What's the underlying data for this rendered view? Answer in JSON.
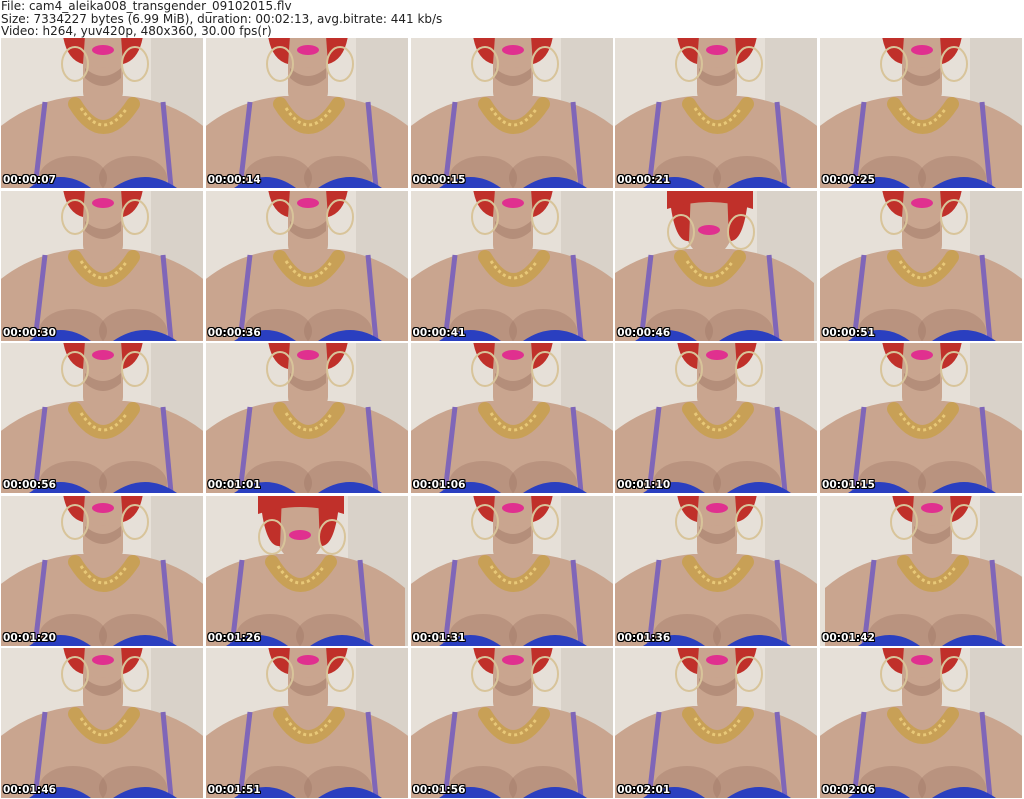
{
  "header": {
    "file_line": "File: cam4_aleika008_transgender_09102015.flv",
    "size_line": "Size: 7334227 bytes (6.99 MiB), duration: 00:02:13, avg.bitrate: 441 kb/s",
    "video_line": "Video: h264, yuv420p, 480x360, 30.00 fps(r)"
  },
  "colors": {
    "wall": "#e6e0d8",
    "skin": "#c9a58f",
    "skin_shadow": "#9c7462",
    "hair": "#c0302a",
    "lips": "#e0308f",
    "necklace": "#c8a050",
    "top": "#2a3fc0",
    "strap": "#7f66b8"
  },
  "thumbnails": [
    {
      "time": "00:00:07",
      "variant": "closeup"
    },
    {
      "time": "00:00:14",
      "variant": "normal"
    },
    {
      "time": "00:00:15",
      "variant": "normal"
    },
    {
      "time": "00:00:21",
      "variant": "normal"
    },
    {
      "time": "00:00:25",
      "variant": "normal"
    },
    {
      "time": "00:00:30",
      "variant": "normal"
    },
    {
      "time": "00:00:36",
      "variant": "normal"
    },
    {
      "time": "00:00:41",
      "variant": "normal"
    },
    {
      "time": "00:00:46",
      "variant": "face"
    },
    {
      "time": "00:00:51",
      "variant": "normal"
    },
    {
      "time": "00:00:56",
      "variant": "normal"
    },
    {
      "time": "00:01:01",
      "variant": "normal"
    },
    {
      "time": "00:01:06",
      "variant": "normal"
    },
    {
      "time": "00:01:10",
      "variant": "normal"
    },
    {
      "time": "00:01:15",
      "variant": "normal"
    },
    {
      "time": "00:01:20",
      "variant": "normal"
    },
    {
      "time": "00:01:26",
      "variant": "face"
    },
    {
      "time": "00:01:31",
      "variant": "normal"
    },
    {
      "time": "00:01:36",
      "variant": "normal"
    },
    {
      "time": "00:01:42",
      "variant": "tilt"
    },
    {
      "time": "00:01:46",
      "variant": "normal"
    },
    {
      "time": "00:01:51",
      "variant": "normal"
    },
    {
      "time": "00:01:56",
      "variant": "normal"
    },
    {
      "time": "00:02:01",
      "variant": "normal"
    },
    {
      "time": "00:02:06",
      "variant": "normal"
    }
  ]
}
